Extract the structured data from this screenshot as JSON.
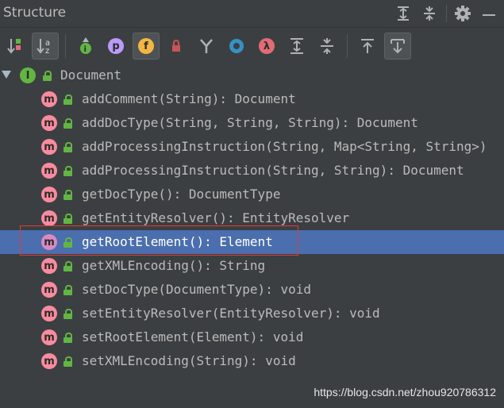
{
  "panel": {
    "title": "Structure"
  },
  "title_icons": [
    "expand-all-icon",
    "collapse-all-icon",
    "gear-icon",
    "minimize-icon"
  ],
  "toolbar": {
    "buttons": [
      {
        "name": "sort-by-visibility-icon",
        "active": false
      },
      {
        "name": "sort-alphabetically-icon",
        "active": true,
        "glyph": "a z"
      },
      {
        "name": "show-inherited-icon",
        "glyph": "I"
      },
      {
        "name": "show-properties-icon",
        "glyph": "p"
      },
      {
        "name": "show-fields-icon",
        "glyph": "f",
        "active": true
      },
      {
        "name": "show-non-public-icon"
      },
      {
        "name": "show-anonymous-icon"
      },
      {
        "name": "show-interfaces-icon"
      },
      {
        "name": "show-lambdas-icon",
        "glyph": "λ"
      },
      {
        "name": "expand-all-icon"
      },
      {
        "name": "collapse-all-icon"
      },
      {
        "name": "autoscroll-to-source-icon"
      },
      {
        "name": "autoscroll-from-source-icon",
        "active": true
      }
    ]
  },
  "tree": {
    "root": {
      "icon_letter": "I",
      "label": "Document"
    },
    "method_icon_letter": "m",
    "items": [
      {
        "label": "addComment(String): Document"
      },
      {
        "label": "addDocType(String, String, String): Document"
      },
      {
        "label": "addProcessingInstruction(String, Map<String, String>)"
      },
      {
        "label": "addProcessingInstruction(String, String): Document"
      },
      {
        "label": "getDocType(): DocumentType"
      },
      {
        "label": "getEntityResolver(): EntityResolver"
      },
      {
        "label": "getRootElement(): Element",
        "selected": true
      },
      {
        "label": "getXMLEncoding(): String"
      },
      {
        "label": "setDocType(DocumentType): void"
      },
      {
        "label": "setEntityResolver(EntityResolver): void"
      },
      {
        "label": "setRootElement(Element): void"
      },
      {
        "label": "setXMLEncoding(String): void"
      }
    ]
  },
  "watermark": "https://blog.csdn.net/zhou920786312",
  "colors": {
    "background": "#3c3f41",
    "selection": "#4b6eaf",
    "method_icon": "#f98b9e",
    "interface_icon": "#62b543",
    "highlight_border": "#e03a3a"
  }
}
